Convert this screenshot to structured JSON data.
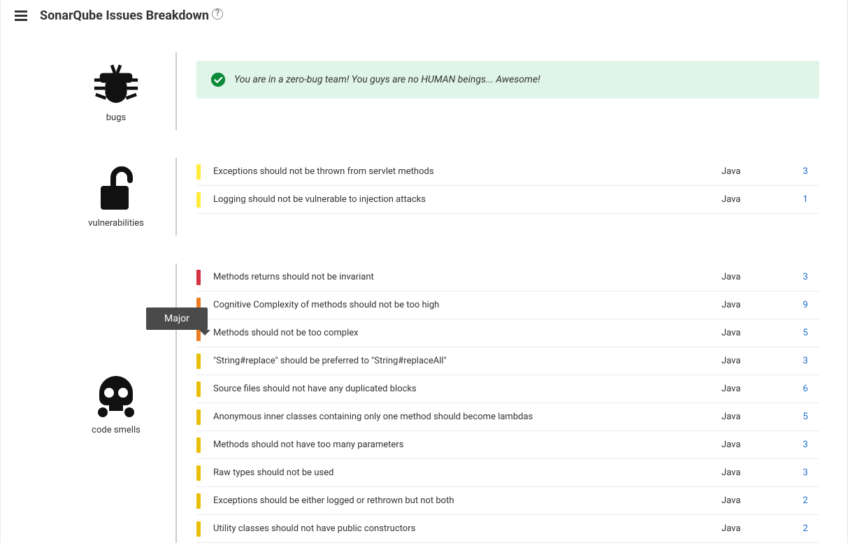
{
  "header": {
    "title": "SonarQube Issues Breakdown"
  },
  "tooltip": "Major",
  "sections": [
    {
      "key": "bugs",
      "label": "bugs",
      "banner": "You are in a zero-bug team! You guys are no HUMAN beings... Awesome!",
      "rows": []
    },
    {
      "key": "vulnerabilities",
      "label": "vulnerabilities",
      "rows": [
        {
          "sev": "yellow",
          "name": "Exceptions should not be thrown from servlet methods",
          "lang": "Java",
          "count": 3
        },
        {
          "sev": "yellow",
          "name": "Logging should not be vulnerable to injection attacks",
          "lang": "Java",
          "count": 1
        }
      ]
    },
    {
      "key": "codesmells",
      "label": "code smells",
      "rows": [
        {
          "sev": "red",
          "name": "Methods returns should not be invariant",
          "lang": "Java",
          "count": 3
        },
        {
          "sev": "orange",
          "name": "Cognitive Complexity of methods should not be too high",
          "lang": "Java",
          "count": 9
        },
        {
          "sev": "orange",
          "name": "Methods should not be too complex",
          "lang": "Java",
          "count": 5
        },
        {
          "sev": "gold",
          "name": "\"String#replace\" should be preferred to \"String#replaceAll\"",
          "lang": "Java",
          "count": 3
        },
        {
          "sev": "gold",
          "name": "Source files should not have any duplicated blocks",
          "lang": "Java",
          "count": 6
        },
        {
          "sev": "gold",
          "name": "Anonymous inner classes containing only one method should become lambdas",
          "lang": "Java",
          "count": 5
        },
        {
          "sev": "gold",
          "name": "Methods should not have too many parameters",
          "lang": "Java",
          "count": 3
        },
        {
          "sev": "gold",
          "name": "Raw types should not be used",
          "lang": "Java",
          "count": 3
        },
        {
          "sev": "gold",
          "name": "Exceptions should be either logged or rethrown but not both",
          "lang": "Java",
          "count": 2
        },
        {
          "sev": "gold",
          "name": "Utility classes should not have public constructors",
          "lang": "Java",
          "count": 2
        }
      ]
    }
  ]
}
